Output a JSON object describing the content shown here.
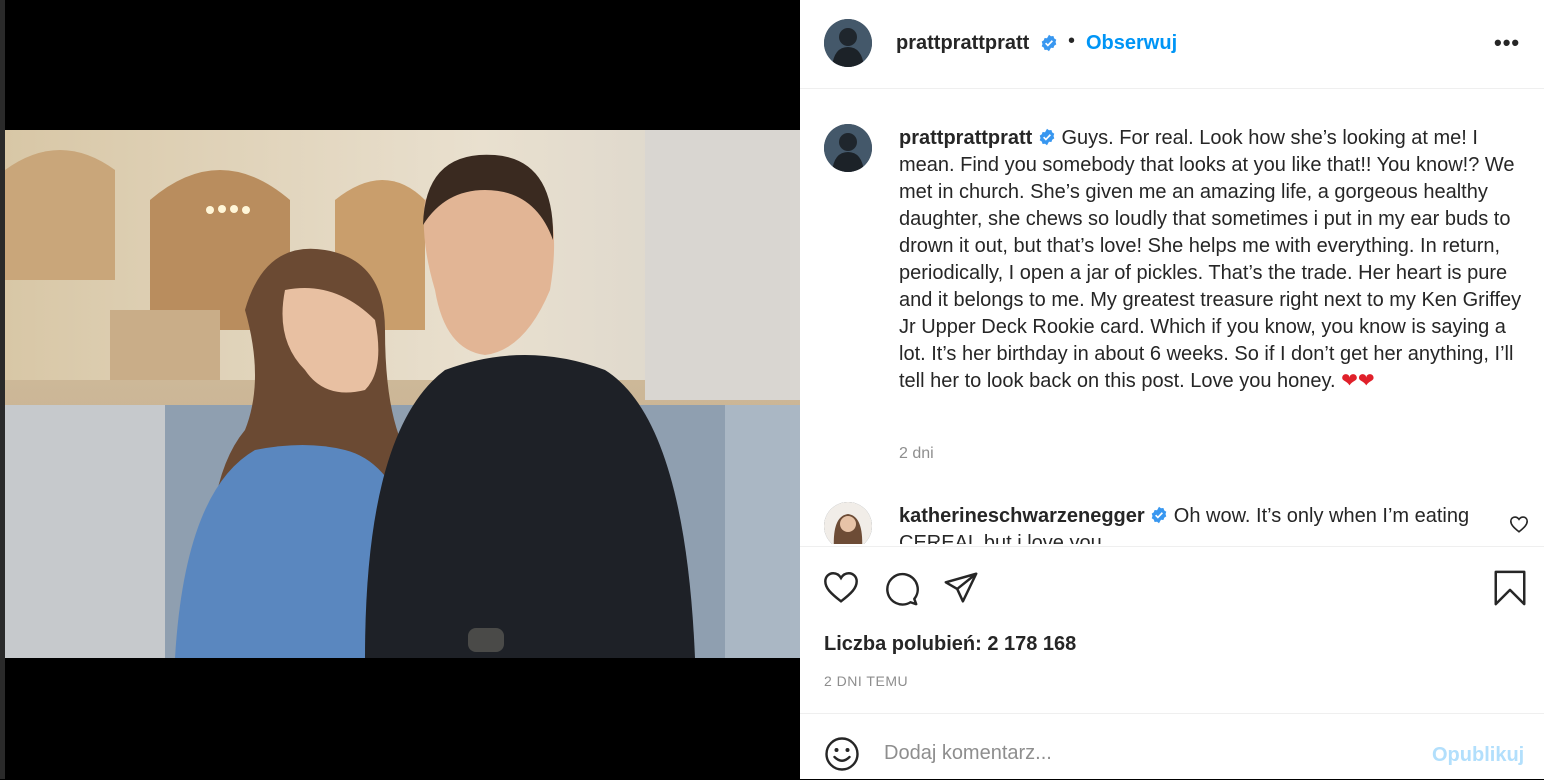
{
  "post": {
    "author": "prattprattpratt",
    "follow_label": "Obserwuj",
    "separator": "•",
    "more_label": "•••",
    "verified_icon": "verified-badge-icon"
  },
  "caption": {
    "author": "prattprattpratt",
    "text": "Guys. For real. Look how she’s looking at me! I mean. Find you somebody that looks at you like that!! You know!? We met in church. She’s given me an amazing life, a gorgeous healthy daughter, she chews so loudly that sometimes i put in my ear buds to drown it out, but that’s love! She helps me with everything. In return, periodically, I open a jar of pickles. That’s the trade. Her heart is pure and it belongs to me. My greatest treasure right next to my Ken Griffey Jr Upper Deck Rookie card. Which if you know, you know is saying a lot. It’s her birthday in about 6 weeks. So if I don’t get her anything, I’ll tell her to look back on this post. Love you honey.",
    "emojis": "❤❤",
    "time": "2 dni"
  },
  "comment": {
    "author": "katherineschwarzenegger",
    "text": "Oh wow. It’s only when I’m eating CEREAL but i love you"
  },
  "stats": {
    "likes_label": "Liczba polubień: 2 178 168",
    "date_label": "2 DNI TEMU"
  },
  "add_comment": {
    "placeholder": "Dodaj komentarz...",
    "post_label": "Opublikuj"
  },
  "icons": [
    "heart-icon",
    "comment-icon",
    "share-icon",
    "bookmark-icon",
    "emoji-icon",
    "more-icon"
  ],
  "colors": {
    "link": "#0095f6",
    "verified": "#3897f0",
    "muted": "#8e8e8e",
    "post_disabled": "#b2dffc",
    "emoji_heart": "#e0202a"
  }
}
